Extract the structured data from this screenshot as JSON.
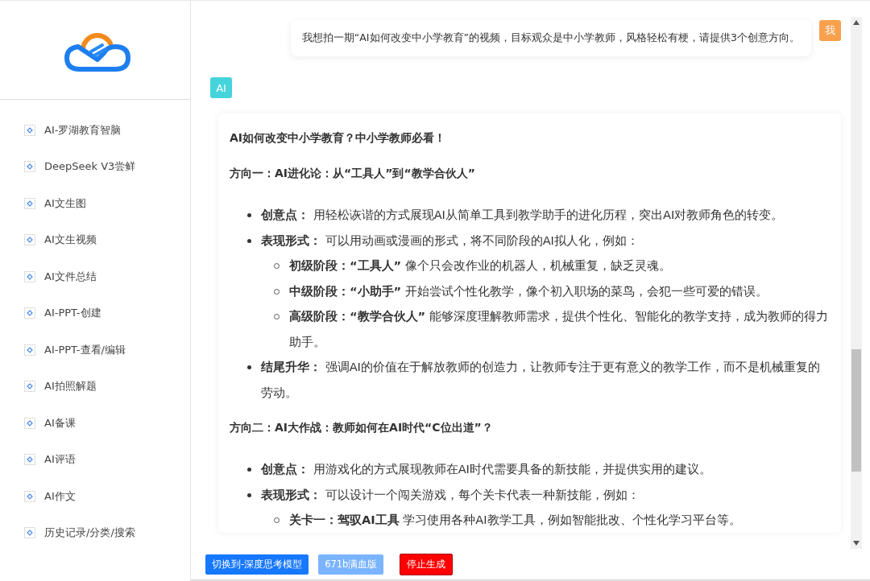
{
  "sidebar": {
    "items": [
      {
        "label": "AI-罗湖教育智脑",
        "selected": false
      },
      {
        "label": "DeepSeek V3尝鲜",
        "selected": false
      },
      {
        "label": "AI文生图",
        "selected": false
      },
      {
        "label": "AI文生视频",
        "selected": false
      },
      {
        "label": "AI文件总结",
        "selected": false
      },
      {
        "label": "AI-PPT-创建",
        "selected": false
      },
      {
        "label": "AI-PPT-查看/编辑",
        "selected": false
      },
      {
        "label": "AI拍照解题",
        "selected": false
      },
      {
        "label": "AI备课",
        "selected": false
      },
      {
        "label": "AI评语",
        "selected": false
      },
      {
        "label": "AI作文",
        "selected": false
      },
      {
        "label": "历史记录/分类/搜索",
        "selected": false
      }
    ]
  },
  "chat": {
    "user_message": {
      "avatar": "我",
      "text": "我想拍一期“AI如何改变中小学教育”的视频，目标观众是中小学教师，风格轻松有梗，请提供3个创意方向。"
    },
    "ai_avatar": "AI",
    "answer": [
      {
        "kind": "title",
        "text": "AI如何改变中小学教育？中小学教师必看！"
      },
      {
        "kind": "heading",
        "text": "方向一：AI进化论：从“工具人”到“教学合伙人”"
      },
      {
        "kind": "list",
        "items": [
          {
            "text": "**创意点：** 用轻松诙谐的方式展现AI从简单工具到教学助手的进化历程，突出AI对教师角色的转变。"
          },
          {
            "text": "**表现形式：** 可以用动画或漫画的形式，将不同阶段的AI拟人化，例如：",
            "children": [
              {
                "text": "**初级阶段：“工具人”** 像个只会改作业的机器人，机械重复，缺乏灵魂。"
              },
              {
                "text": "**中级阶段：“小助手”** 开始尝试个性化教学，像个初入职场的菜鸟，会犯一些可爱的错误。"
              },
              {
                "text": "**高级阶段：“教学合伙人”** 能够深度理解教师需求，提供个性化、智能化的教学支持，成为教师的得力助手。"
              }
            ]
          },
          {
            "text": "**结尾升华：** 强调AI的价值在于解放教师的创造力，让教师专注于更有意义的教学工作，而不是机械重复的劳动。"
          }
        ]
      },
      {
        "kind": "heading",
        "text": "方向二：AI大作战：教师如何在AI时代“C位出道”？"
      },
      {
        "kind": "list",
        "items": [
          {
            "text": "**创意点：** 用游戏化的方式展现教师在AI时代需要具备的新技能，并提供实用的建议。"
          },
          {
            "text": "**表现形式：** 可以设计一个闯关游戏，每个关卡代表一种新技能，例如：",
            "children": [
              {
                "text": "**关卡一：驾驭AI工具** 学习使用各种AI教学工具，例如智能批改、个性化学习平台等。"
              }
            ]
          }
        ]
      }
    ]
  },
  "buttons": [
    {
      "label": "切换到-深度思考模型",
      "kind": "primary"
    },
    {
      "label": "671b满血版",
      "kind": "secondary"
    },
    {
      "label": "停止生成",
      "kind": "danger"
    }
  ]
}
